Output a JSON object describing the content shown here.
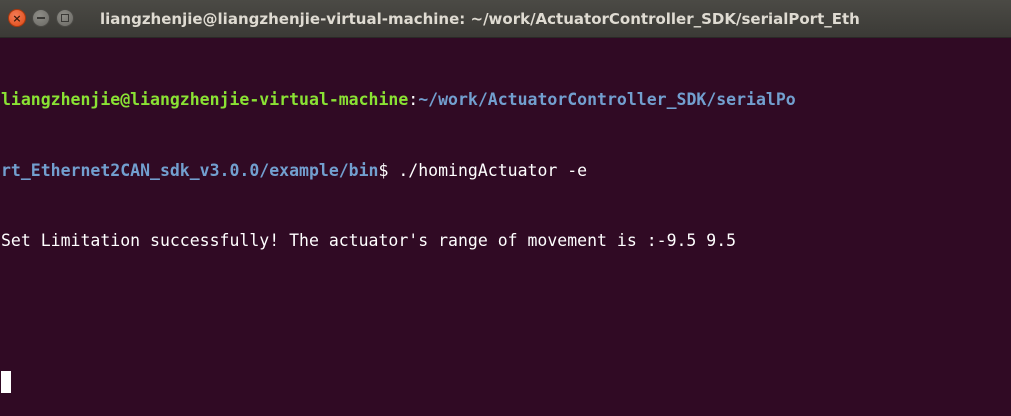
{
  "window": {
    "title": "liangzhenjie@liangzhenjie-virtual-machine: ~/work/ActuatorController_SDK/serialPort_Eth",
    "controls": {
      "close_glyph": "×",
      "close_icon": "close-icon",
      "minimize_icon": "minimize-icon",
      "maximize_icon": "maximize-icon"
    }
  },
  "terminal": {
    "prompt": {
      "user_host": "liangzhenjie@liangzhenjie-virtual-machine",
      "separator": ":",
      "path_line1": "~/work/ActuatorController_SDK/serialPo",
      "path_line2": "rt_Ethernet2CAN_sdk_v3.0.0/example/bin",
      "symbol": "$ ",
      "command": "./homingActuator -e"
    },
    "output": [
      "Set Limitation successfully! The actuator's range of movement is :-9.5 9.5"
    ]
  },
  "colors": {
    "background": "#300a24",
    "user_host": "#8ae234",
    "path": "#729fcf",
    "text": "#ffffff",
    "close_button": "#df4a16"
  }
}
